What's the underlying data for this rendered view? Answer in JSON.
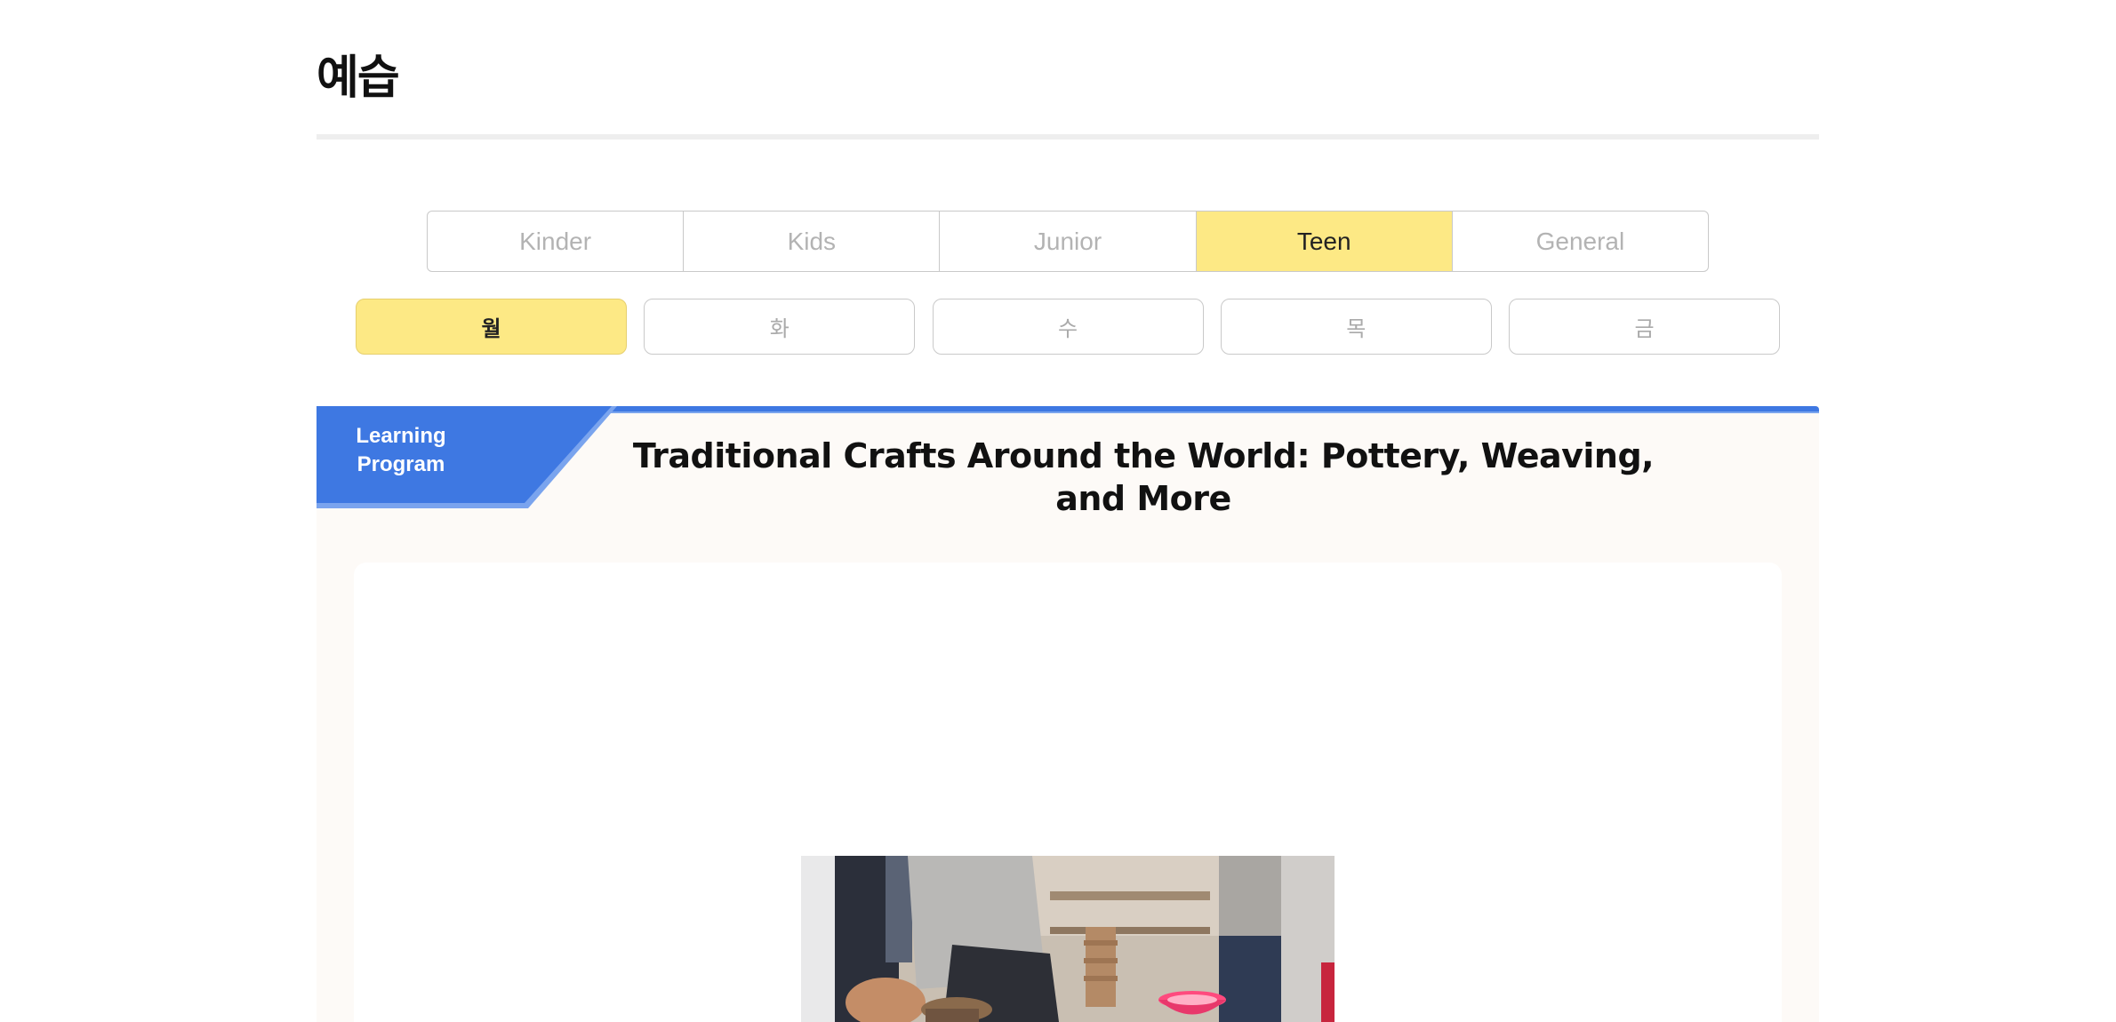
{
  "page": {
    "title": "예습"
  },
  "level_tabs": [
    {
      "label": "Kinder",
      "active": false
    },
    {
      "label": "Kids",
      "active": false
    },
    {
      "label": "Junior",
      "active": false
    },
    {
      "label": "Teen",
      "active": true
    },
    {
      "label": "General",
      "active": false
    }
  ],
  "day_tabs": [
    {
      "label": "월",
      "active": true
    },
    {
      "label": "화",
      "active": false
    },
    {
      "label": "수",
      "active": false
    },
    {
      "label": "목",
      "active": false
    },
    {
      "label": "금",
      "active": false
    }
  ],
  "program": {
    "badge_line1": "Learning",
    "badge_line2": "Program",
    "title": "Traditional Crafts Around the World: Pottery, Weaving, and More"
  },
  "colors": {
    "accent_yellow": "#fde985",
    "accent_blue": "#3e78e2",
    "section_bg": "#fdfaf7"
  },
  "image": {
    "subject": "pottery-workshop-photo"
  }
}
